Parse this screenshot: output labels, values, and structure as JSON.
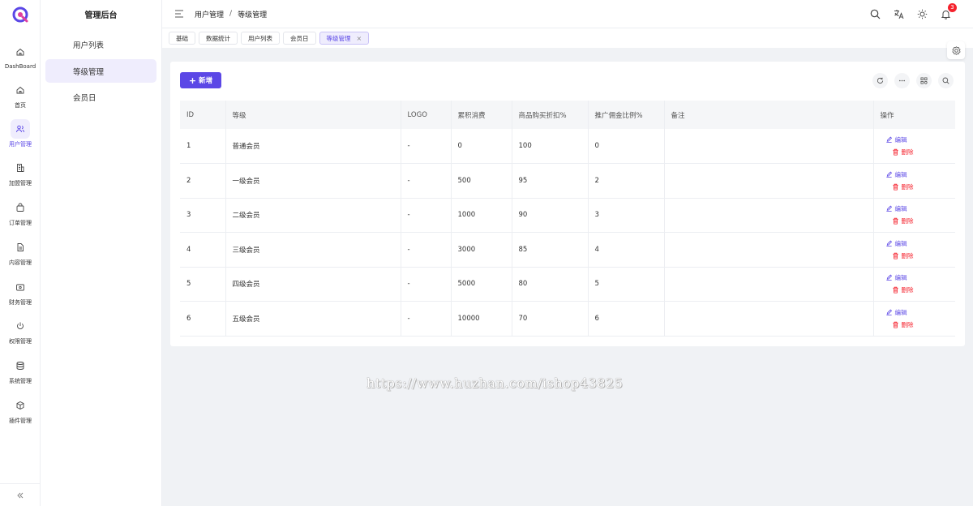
{
  "app": {
    "title": "管理后台"
  },
  "rail": {
    "items": [
      {
        "label": "DashBoard",
        "icon": "home-icon",
        "active": false
      },
      {
        "label": "首页",
        "icon": "home-icon",
        "active": false
      },
      {
        "label": "用户管理",
        "icon": "users-icon",
        "active": true
      },
      {
        "label": "加盟管理",
        "icon": "building-icon",
        "active": false
      },
      {
        "label": "订单管理",
        "icon": "bag-icon",
        "active": false
      },
      {
        "label": "内容管理",
        "icon": "document-icon",
        "active": false
      },
      {
        "label": "财务管理",
        "icon": "wallet-icon",
        "active": false
      },
      {
        "label": "权限管理",
        "icon": "power-icon",
        "active": false
      },
      {
        "label": "系统管理",
        "icon": "database-icon",
        "active": false
      },
      {
        "label": "插件管理",
        "icon": "cube-icon",
        "active": false
      }
    ]
  },
  "submenu": {
    "items": [
      {
        "label": "用户列表",
        "active": false
      },
      {
        "label": "等级管理",
        "active": true
      },
      {
        "label": "会员日",
        "active": false
      }
    ]
  },
  "header": {
    "breadcrumb": [
      "用户管理",
      "等级管理"
    ],
    "separator": "/",
    "notification_count": "3"
  },
  "tabs": [
    {
      "label": "基础",
      "active": false
    },
    {
      "label": "数据统计",
      "active": false
    },
    {
      "label": "用户列表",
      "active": false
    },
    {
      "label": "会员日",
      "active": false
    },
    {
      "label": "等级管理",
      "active": true
    }
  ],
  "toolbar": {
    "add_label": "新增"
  },
  "table": {
    "columns": [
      "ID",
      "等级",
      "LOGO",
      "累积消费",
      "商品购买折扣%",
      "推广佣金比例%",
      "备注",
      "操作"
    ],
    "rows": [
      {
        "id": "1",
        "level": "普通会员",
        "logo": "-",
        "spend": "0",
        "discount": "100",
        "commission": "0",
        "note": ""
      },
      {
        "id": "2",
        "level": "一级会员",
        "logo": "-",
        "spend": "500",
        "discount": "95",
        "commission": "2",
        "note": ""
      },
      {
        "id": "3",
        "level": "二级会员",
        "logo": "-",
        "spend": "1000",
        "discount": "90",
        "commission": "3",
        "note": ""
      },
      {
        "id": "4",
        "level": "三级会员",
        "logo": "-",
        "spend": "3000",
        "discount": "85",
        "commission": "4",
        "note": ""
      },
      {
        "id": "5",
        "level": "四级会员",
        "logo": "-",
        "spend": "5000",
        "discount": "80",
        "commission": "5",
        "note": ""
      },
      {
        "id": "6",
        "level": "五级会员",
        "logo": "-",
        "spend": "10000",
        "discount": "70",
        "commission": "6",
        "note": ""
      }
    ],
    "edit_label": "编辑",
    "delete_label": "删除"
  },
  "watermark": "https://www.huzhan.com/ishop43825",
  "colors": {
    "primary": "#5b47e6",
    "danger": "#f5222d",
    "active_bg": "#efedfd"
  }
}
